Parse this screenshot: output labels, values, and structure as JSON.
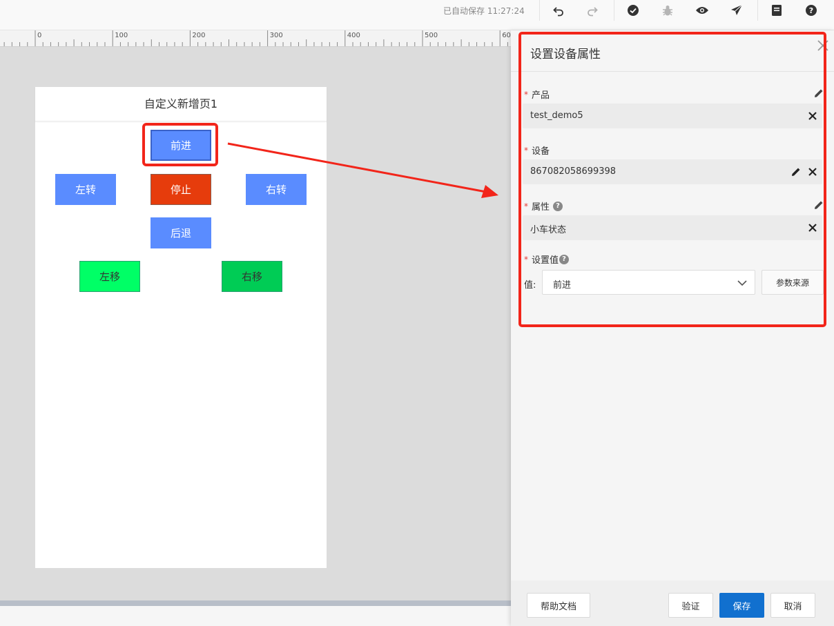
{
  "toolbar": {
    "autosave": "已自动保存 11:27:24",
    "icons": [
      "undo-icon",
      "redo-icon",
      "check-circle-icon",
      "bug-icon",
      "eye-icon",
      "send-icon",
      "doc-icon",
      "help-icon"
    ]
  },
  "ruler": {
    "labels": [
      "0",
      "100",
      "200",
      "300",
      "400",
      "500",
      "60"
    ]
  },
  "page": {
    "title": "自定义新增页1",
    "buttons": {
      "forward": "前进",
      "left_turn": "左转",
      "stop": "停止",
      "right_turn": "右转",
      "back": "后退",
      "left_move": "左移",
      "right_move": "右移"
    }
  },
  "panel": {
    "title": "设置设备属性",
    "product": {
      "label": "产品",
      "value": "test_demo5"
    },
    "device": {
      "label": "设备",
      "value": "867082058699398"
    },
    "property": {
      "label": "属性",
      "value": "小车状态"
    },
    "set_value": {
      "label": "设置值",
      "value_label": "值:",
      "selected": "前进",
      "source_button": "参数来源"
    },
    "footer": {
      "help": "帮助文档",
      "verify": "验证",
      "save": "保存",
      "cancel": "取消"
    }
  },
  "colors": {
    "accent_blue": "#5a8cff",
    "stop_red": "#e63c0c",
    "green_light": "#00ff66",
    "green_dark": "#00cc55",
    "primary_button": "#1170cf",
    "annotation_red": "#f2251a"
  }
}
